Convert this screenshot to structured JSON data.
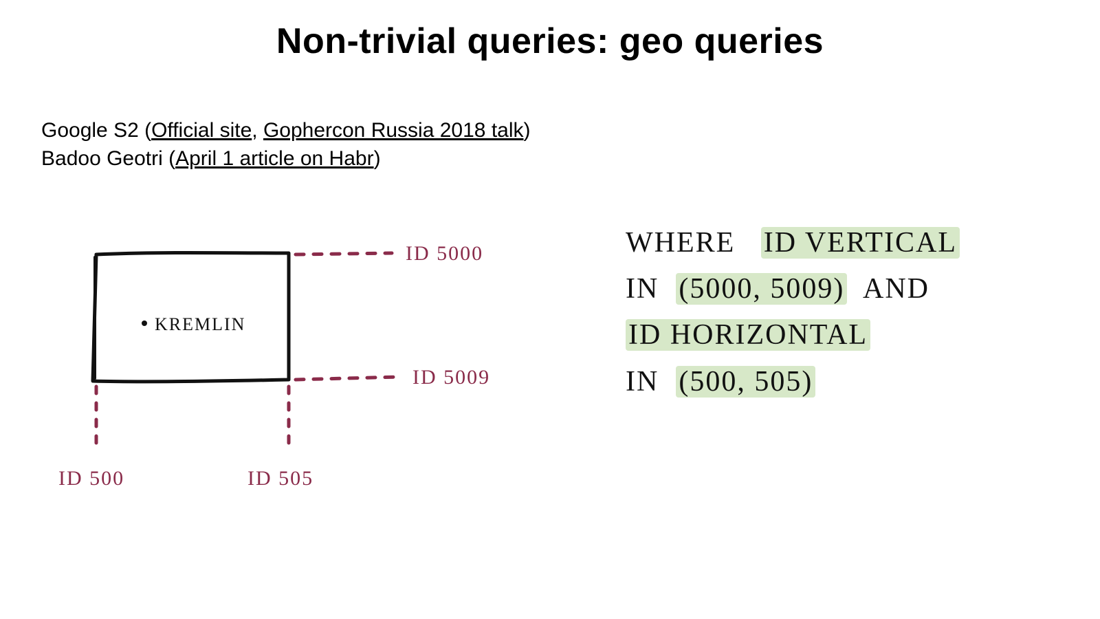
{
  "title": "Non-trivial queries: geo queries",
  "refs": {
    "line1_prefix": "Google S2 (",
    "line1_link1": "Official site",
    "line1_sep": ", ",
    "line1_link2": "Gophercon Russia 2018 talk",
    "line1_suffix": ")",
    "line2_prefix": "Badoo Geotri (",
    "line2_link1": "April 1 article on Habr",
    "line2_suffix": ")"
  },
  "diagram": {
    "point_label": "KREMLIN",
    "top_id": "ID 5000",
    "bottom_id": "ID 5009",
    "left_id": "ID 500",
    "right_id": "ID 505"
  },
  "query": {
    "w_where": "WHERE",
    "w_id_vertical": "ID  VERTICAL",
    "w_in1": "IN",
    "w_range1": "(5000, 5009)",
    "w_and": "AND",
    "w_id_horizontal": "ID  HORIZONTAL",
    "w_in2": "IN",
    "w_range2": "(500, 505)"
  },
  "colors": {
    "ink": "#8a2b4a",
    "highlight": "#d7e8c8"
  }
}
